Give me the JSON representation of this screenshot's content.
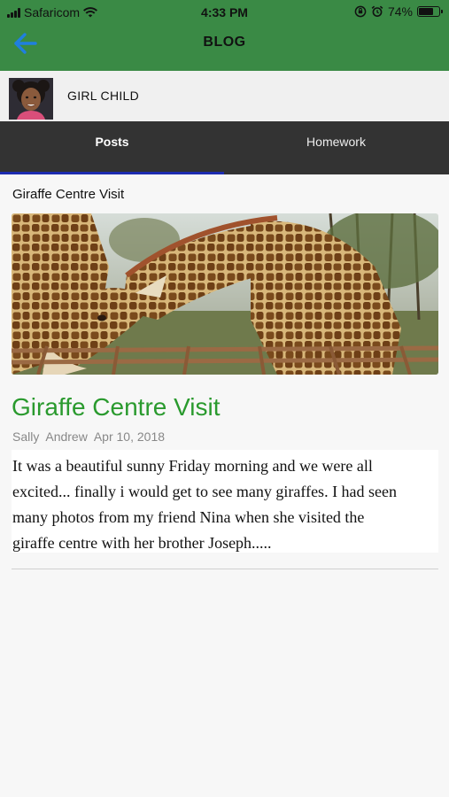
{
  "status_bar": {
    "carrier": "Safaricom",
    "time": "4:33 PM",
    "battery_text": "74%",
    "battery_level": 0.74,
    "icons": [
      "signal-icon",
      "wifi-icon",
      "orientation-lock-icon",
      "alarm-icon",
      "battery-icon"
    ]
  },
  "nav": {
    "title": "BLOG",
    "back_icon": "arrow-left-icon"
  },
  "profile": {
    "name": "GIRL  CHILD",
    "avatar": "child-avatar"
  },
  "tabs": [
    {
      "label": "Posts",
      "active": true
    },
    {
      "label": "Homework",
      "active": false
    }
  ],
  "post": {
    "header_title": "Giraffe Centre Visit",
    "image": "giraffes-photo",
    "title": "Giraffe Centre Visit",
    "author": "Sally  Andrew",
    "date": "Apr 10, 2018",
    "excerpt_lines": [
      "It was a beautiful sunny Friday morning and we were all",
      "excited... finally i would get to see many giraffes. I had seen",
      "many photos from my friend Nina when she visited the",
      "giraffe centre with her brother Joseph....."
    ]
  },
  "colors": {
    "header_green": "#3a8a45",
    "back_arrow_blue": "#1f7fe0",
    "tab_bar": "#333333",
    "tab_indicator": "#1d2cb0",
    "post_title_green": "#2a9a2e"
  }
}
